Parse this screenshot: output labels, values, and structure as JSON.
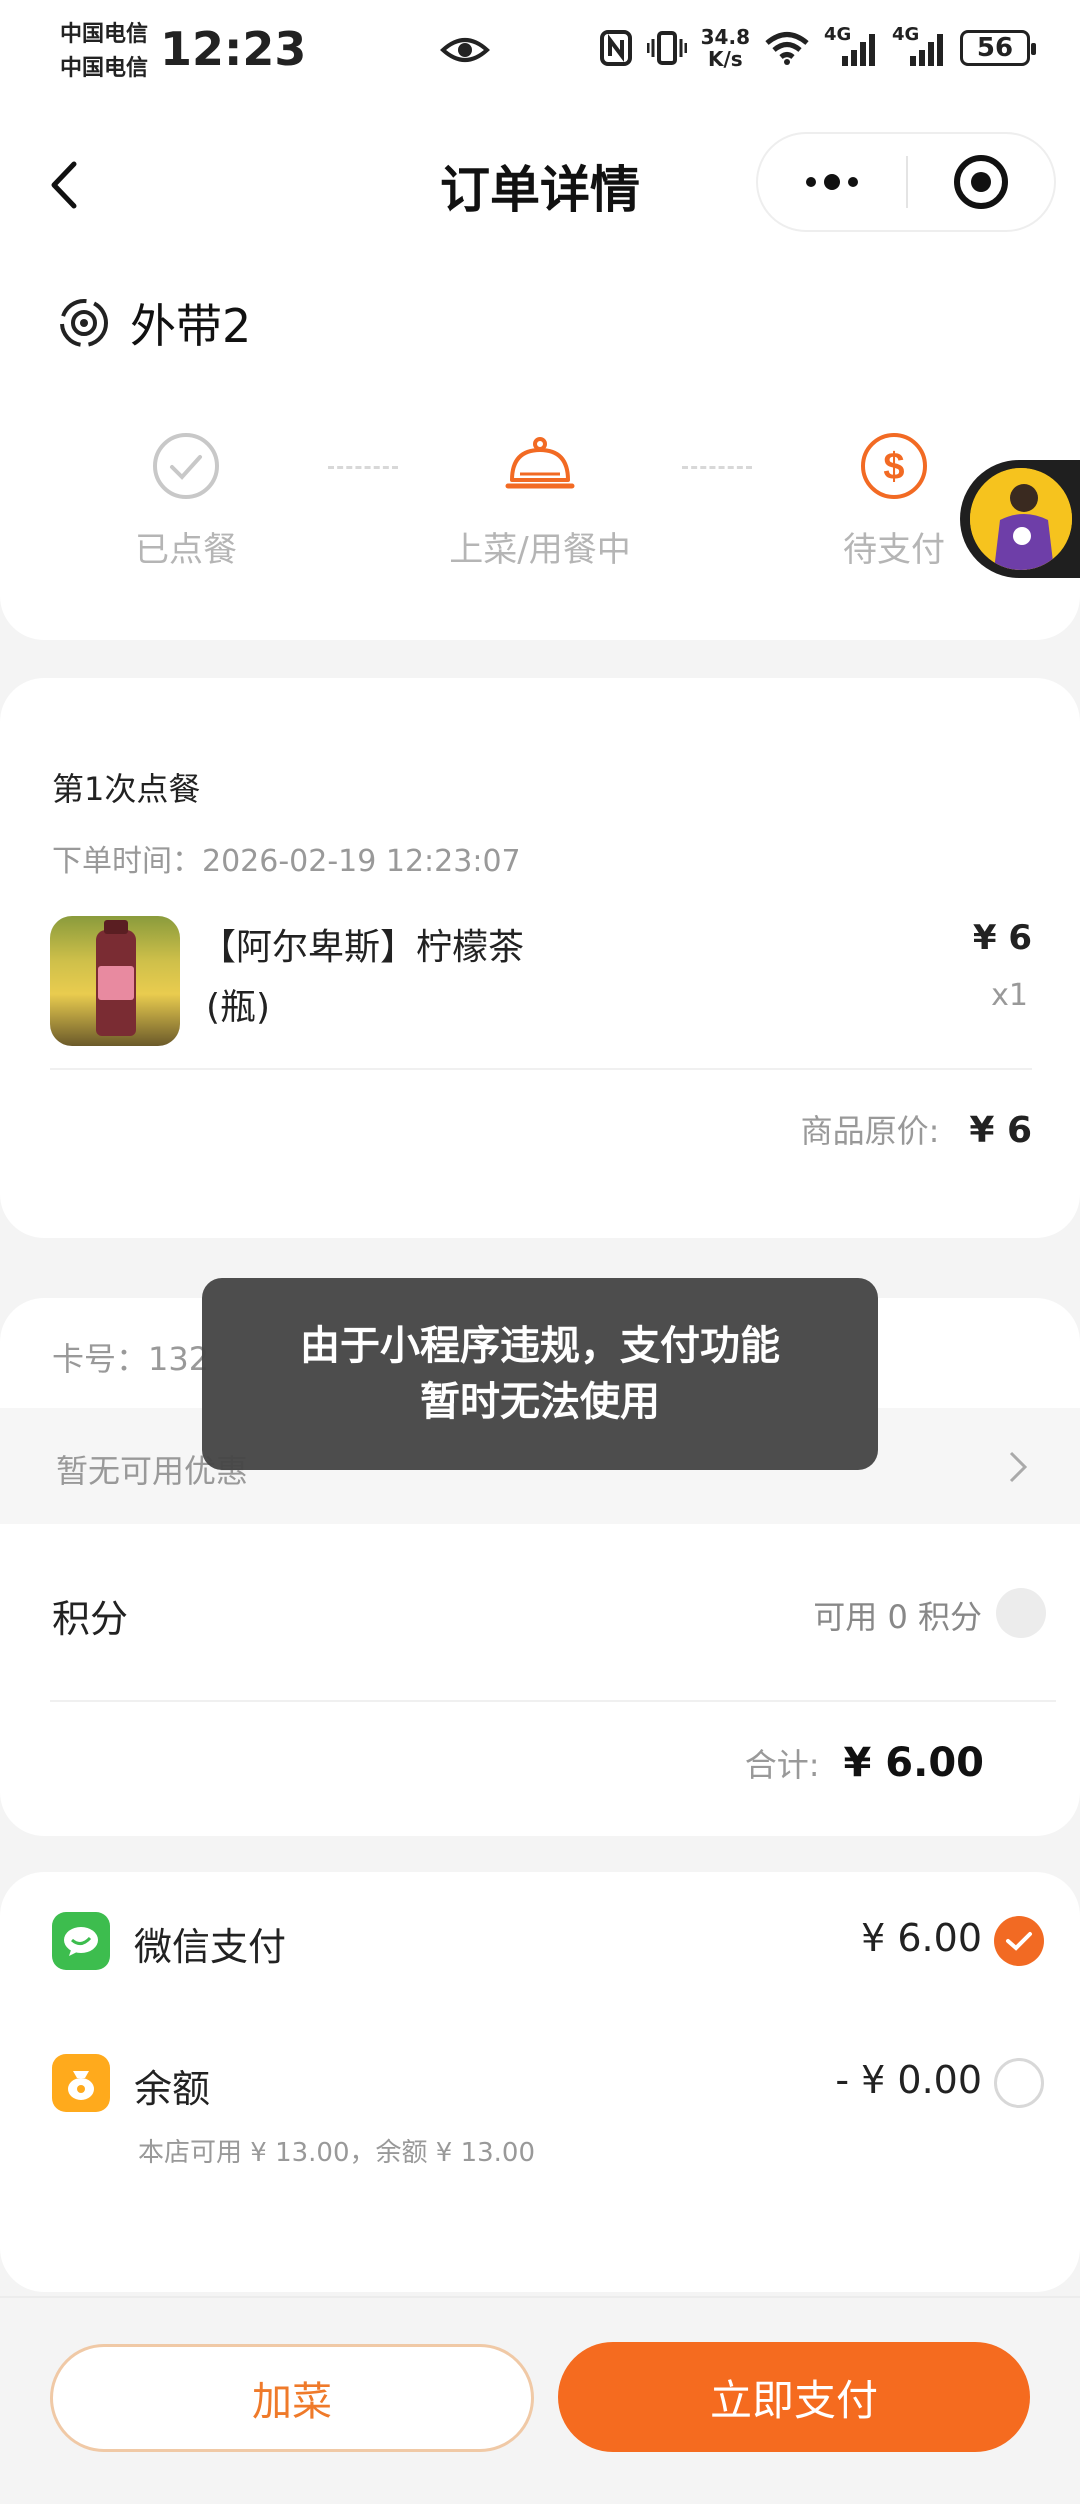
{
  "status_bar": {
    "carrier_1": "中国电信",
    "carrier_2": "中国电信",
    "time": "12:23",
    "net_speed_value": "34.8",
    "net_speed_unit": "K/s",
    "signal_1": "4G",
    "signal_2": "4G",
    "battery": "56"
  },
  "nav": {
    "title": "订单详情",
    "more_icon": "more-dots-icon",
    "close_icon": "target-circle-icon"
  },
  "order_header": {
    "table_name": "外带2",
    "steps": [
      {
        "label": "已点餐",
        "state": "done",
        "icon": "check-circle-icon"
      },
      {
        "label": "上菜/用餐中",
        "state": "current",
        "icon": "cloche-icon"
      },
      {
        "label": "待支付",
        "state": "current",
        "icon": "dollar-circle-icon"
      }
    ]
  },
  "order": {
    "round_title": "第1次点餐",
    "order_time_label": "下单时间：",
    "order_time": "2026-02-19 12:23:07",
    "items": [
      {
        "name": "【阿尔卑斯】柠檬茶",
        "spec": "(瓶)",
        "price": "¥ 6",
        "qty": "x1"
      }
    ],
    "original_price_label": "商品原价:",
    "original_price": "¥ 6"
  },
  "payment": {
    "card_no_label": "卡号：132",
    "coupon_text": "暂无可用优惠",
    "points_label": "积分",
    "points_available": "可用 0 积分",
    "total_label": "合计:",
    "total": "¥ 6.00"
  },
  "methods": {
    "wechat_name": "微信支付",
    "wechat_amount": "¥ 6.00",
    "balance_name": "余额",
    "balance_amount": "- ¥ 0.00",
    "balance_sub": "本店可用 ¥ 13.00，余额 ¥ 13.00"
  },
  "actions": {
    "add_dish": "加菜",
    "pay_now": "立即支付"
  },
  "toast": {
    "line_1": "由于小程序违规，支付功能",
    "line_2": "暂时无法使用"
  },
  "colors": {
    "accent": "#f56b1f",
    "step_done": "#b5b5b5",
    "wechat_green": "#3dbd4e",
    "balance_orange": "#ffaa1c"
  }
}
